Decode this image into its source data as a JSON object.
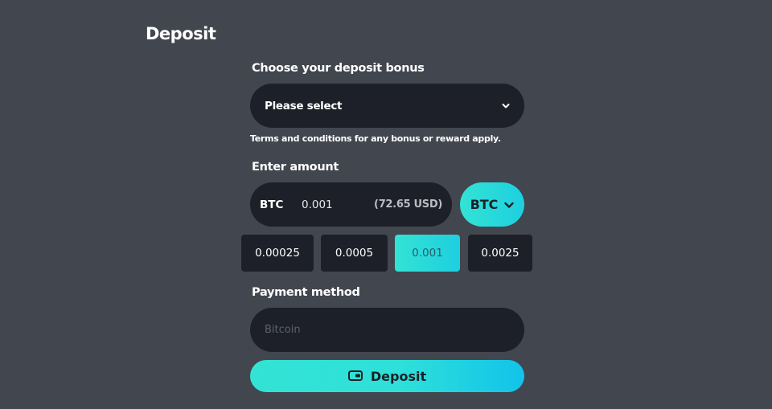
{
  "page": {
    "title": "Deposit"
  },
  "bonus": {
    "label": "Choose your deposit bonus",
    "selected": "Please select",
    "terms": "Terms and conditions for any bonus or reward apply."
  },
  "amount": {
    "label": "Enter amount",
    "currency_code": "BTC",
    "value": "0.001",
    "usd_value": "(72.65 USD)",
    "currency_selector": "BTC"
  },
  "presets": [
    {
      "label": "0.00025",
      "active": false
    },
    {
      "label": "0.0005",
      "active": false
    },
    {
      "label": "0.001",
      "active": true
    },
    {
      "label": "0.0025",
      "active": false
    }
  ],
  "payment": {
    "label": "Payment method",
    "placeholder": "Bitcoin"
  },
  "actions": {
    "deposit": "Deposit"
  },
  "colors": {
    "background": "#42464f",
    "panel": "#1d2028",
    "accent": "#33e3d4",
    "accent_end": "#12c3ea"
  },
  "icons": {
    "bonus_dropdown": "chevron-down-icon",
    "currency_dropdown": "chevron-down-icon",
    "deposit": "wallet-icon"
  }
}
